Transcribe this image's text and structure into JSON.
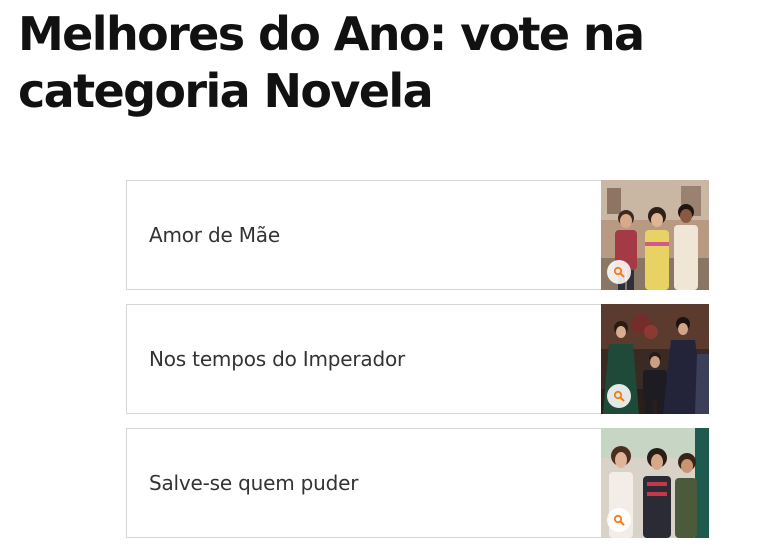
{
  "page": {
    "title": "Melhores do Ano: vote na categoria Novela"
  },
  "poll": {
    "options": [
      {
        "label": "Amor de Mãe",
        "thumb_icon": "zoom-icon"
      },
      {
        "label": "Nos tempos do Imperador",
        "thumb_icon": "zoom-icon"
      },
      {
        "label": "Salve-se quem puder",
        "thumb_icon": "zoom-icon"
      }
    ]
  },
  "colors": {
    "accent": "#f07d1a",
    "border": "#d6d6d6",
    "title": "#111111",
    "label": "#333333"
  }
}
